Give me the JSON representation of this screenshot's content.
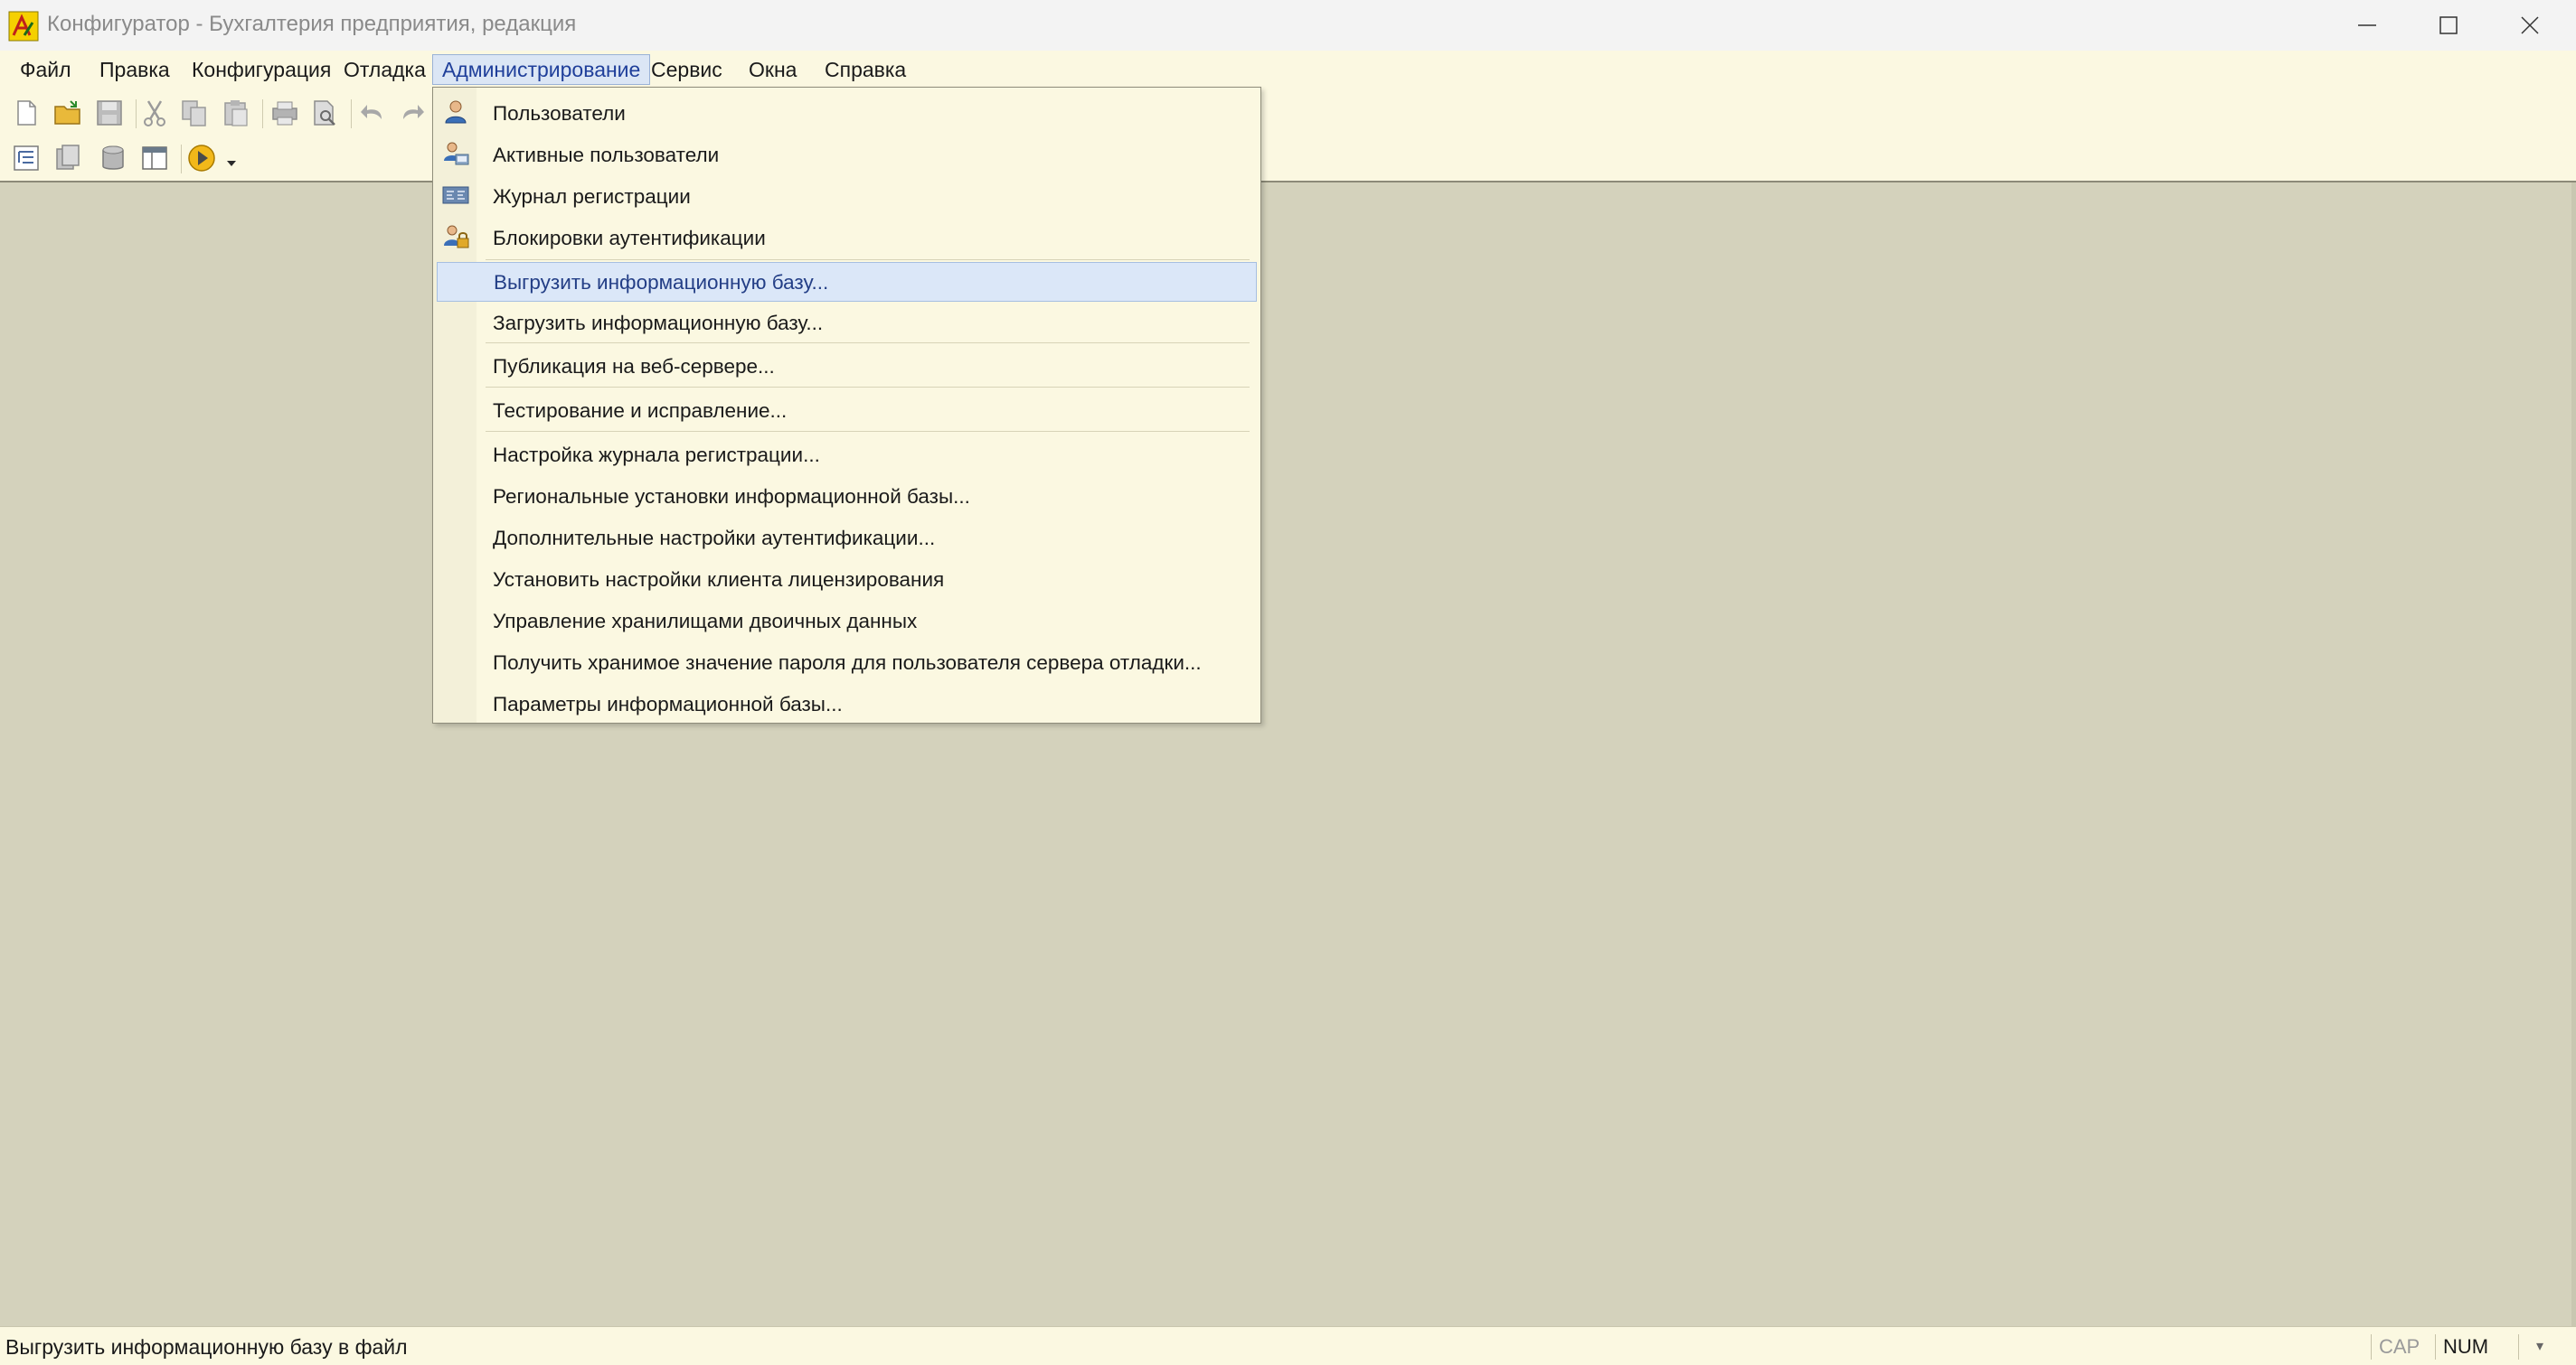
{
  "window": {
    "title": "Конфигуратор - Бухгалтерия предприятия, редакция"
  },
  "menubar": [
    {
      "id": "file",
      "label": "Файл",
      "active": false
    },
    {
      "id": "edit",
      "label": "Правка",
      "active": false
    },
    {
      "id": "config",
      "label": "Конфигурация",
      "active": false
    },
    {
      "id": "debug",
      "label": "Отладка",
      "active": false
    },
    {
      "id": "admin",
      "label": "Администрирование",
      "active": true
    },
    {
      "id": "service",
      "label": "Сервис",
      "active": false
    },
    {
      "id": "windows",
      "label": "Окна",
      "active": false
    },
    {
      "id": "help",
      "label": "Справка",
      "active": false
    }
  ],
  "toolbar": {
    "row1": [
      "new-document-icon",
      "open-folder-icon",
      "save-icon",
      "cut-icon",
      "copy-icon",
      "paste-icon",
      "print-icon",
      "print-preview-icon",
      "undo-icon",
      "redo-icon"
    ],
    "row2": [
      "config-tree-icon",
      "config-properties-icon",
      "database-icon",
      "window-layout-icon",
      "run-debug-icon",
      "dropdown-arrow-icon"
    ]
  },
  "admin_menu": [
    {
      "label": "Пользователи",
      "icon": "user-icon",
      "highlighted": false
    },
    {
      "label": "Активные пользователи",
      "icon": "active-users-icon",
      "highlighted": false
    },
    {
      "label": "Журнал регистрации",
      "icon": "event-log-icon",
      "highlighted": false
    },
    {
      "label": "Блокировки аутентификации",
      "icon": "auth-lock-icon",
      "highlighted": false,
      "separator_after": true
    },
    {
      "label": "Выгрузить информационную базу...",
      "highlighted": true
    },
    {
      "label": "Загрузить информационную базу...",
      "highlighted": false,
      "separator_after": true
    },
    {
      "label": "Публикация на веб-сервере...",
      "highlighted": false,
      "separator_after": true
    },
    {
      "label": "Тестирование и исправление...",
      "highlighted": false,
      "separator_after": true
    },
    {
      "label": "Настройка журнала регистрации...",
      "highlighted": false
    },
    {
      "label": "Региональные установки информационной базы...",
      "highlighted": false
    },
    {
      "label": "Дополнительные настройки аутентификации...",
      "highlighted": false
    },
    {
      "label": "Установить настройки клиента лицензирования",
      "highlighted": false
    },
    {
      "label": "Управление хранилищами двоичных данных",
      "highlighted": false
    },
    {
      "label": "Получить хранимое значение пароля для пользователя сервера отладки...",
      "highlighted": false
    },
    {
      "label": "Параметры информационной базы...",
      "highlighted": false
    }
  ],
  "statusbar": {
    "text": "Выгрузить информационную базу в файл",
    "cap": "CAP",
    "num": "NUM"
  },
  "colors": {
    "menu_bg": "#fbf8e1",
    "workspace_bg": "#d4d2bc",
    "highlight_bg": "#dbe7f8",
    "highlight_text": "#233e86"
  }
}
